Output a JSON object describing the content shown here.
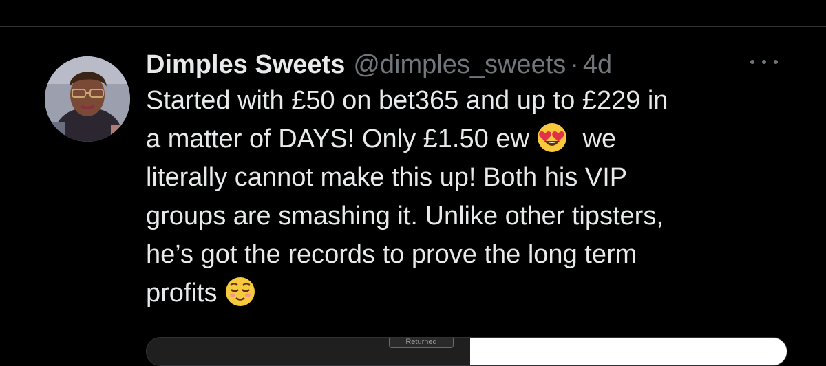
{
  "tweet": {
    "author_name": "Dimples Sweets",
    "handle": "@dimples_sweets",
    "separator": "·",
    "age": "4d",
    "more_icon": "more-horizontal-icon",
    "lines": [
      "Started with £50 on bet365 and up to £229 in",
      "a matter of DAYS! Only £1.50 ew",
      "we",
      "literally cannot make this up! Both his VIP",
      "groups are smashing it. Unlike other tipsters,",
      "he’s got the records to prove the long term",
      "profits"
    ],
    "emojis": [
      "heart-eyes-emoji",
      "relieved-face-emoji"
    ]
  },
  "media": {
    "label": "Returned"
  },
  "colors": {
    "background": "#000000",
    "text": "#e7e9ea",
    "muted": "#71767b",
    "divider": "#2f3336"
  }
}
